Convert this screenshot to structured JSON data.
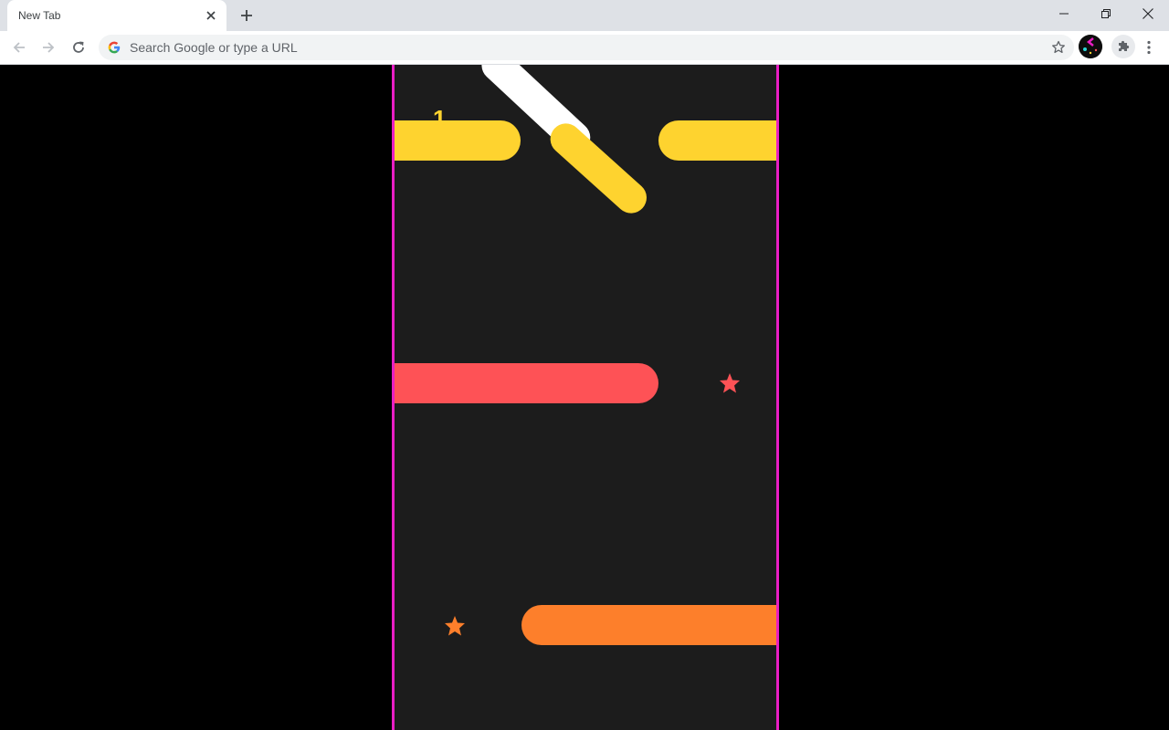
{
  "browser": {
    "tab_title": "New Tab",
    "omnibox_placeholder": "Search Google or type a URL",
    "icons": {
      "back": "arrow-left-icon",
      "forward": "arrow-right-icon",
      "reload": "reload-icon",
      "bookmark": "star-outline-icon",
      "extensions": "puzzle-icon",
      "menu": "kebab-menu-icon",
      "new_tab": "plus-icon",
      "close_tab": "close-icon",
      "minimize": "minimize-icon",
      "maximize": "restore-icon",
      "close_window": "close-icon"
    }
  },
  "game": {
    "score": "1",
    "colors": {
      "border": "#e91ec4",
      "background": "#1c1c1c",
      "yellow": "#fed32f",
      "red": "#fe5256",
      "orange": "#fd7f2b",
      "white": "#ffffff"
    }
  }
}
